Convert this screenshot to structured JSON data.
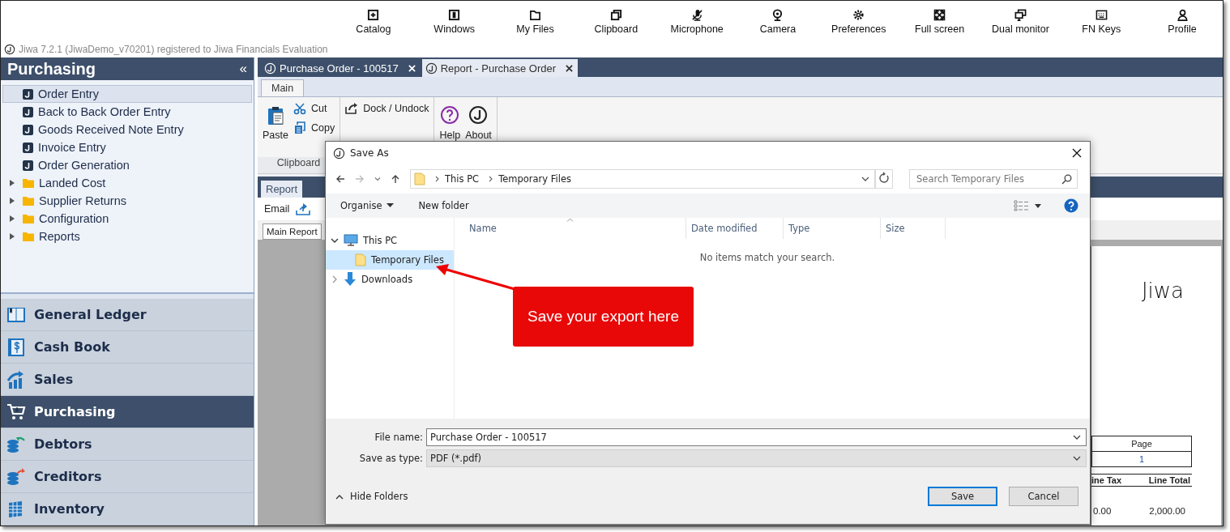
{
  "toolbar": [
    {
      "label": "Catalog"
    },
    {
      "label": "Windows"
    },
    {
      "label": "My Files"
    },
    {
      "label": "Clipboard"
    },
    {
      "label": "Microphone"
    },
    {
      "label": "Camera"
    },
    {
      "label": "Preferences"
    },
    {
      "label": "Full screen"
    },
    {
      "label": "Dual monitor"
    },
    {
      "label": "FN Keys"
    },
    {
      "label": "Profile"
    }
  ],
  "app_title": "Jiwa 7.2.1 (JiwaDemo_v70201) registered to Jiwa Financials Evaluation",
  "sidebar": {
    "title": "Purchasing",
    "collapse": "«",
    "items": [
      {
        "label": "Order Entry",
        "kind": "form",
        "selected": true
      },
      {
        "label": "Back to Back Order Entry",
        "kind": "form",
        "selected": false
      },
      {
        "label": "Goods Received Note Entry",
        "kind": "form",
        "selected": false
      },
      {
        "label": "Invoice Entry",
        "kind": "form",
        "selected": false
      },
      {
        "label": "Order Generation",
        "kind": "form",
        "selected": false
      },
      {
        "label": "Landed Cost",
        "kind": "folder",
        "selected": false
      },
      {
        "label": "Supplier Returns",
        "kind": "folder",
        "selected": false
      },
      {
        "label": "Configuration",
        "kind": "folder",
        "selected": false
      },
      {
        "label": "Reports",
        "kind": "folder",
        "selected": false
      }
    ]
  },
  "modules": [
    {
      "label": "General Ledger",
      "selected": false
    },
    {
      "label": "Cash Book",
      "selected": false
    },
    {
      "label": "Sales",
      "selected": false
    },
    {
      "label": "Purchasing",
      "selected": true
    },
    {
      "label": "Debtors",
      "selected": false
    },
    {
      "label": "Creditors",
      "selected": false
    },
    {
      "label": "Inventory",
      "selected": false
    }
  ],
  "document_tabs": [
    {
      "label": "Purchase Order - 100517",
      "selected": false
    },
    {
      "label": "Report - Purchase Order",
      "selected": true
    }
  ],
  "ribbon": {
    "tabs": [
      {
        "label": "Main",
        "selected": true
      }
    ],
    "groups": [
      {
        "label": "Clipboard",
        "buttons": [
          {
            "label": "Paste",
            "kind": "large"
          },
          {
            "label": "Cut",
            "kind": "small"
          },
          {
            "label": "Copy",
            "kind": "small"
          }
        ]
      },
      {
        "buttons": [
          {
            "label": "Dock / Undock",
            "kind": "small"
          }
        ]
      },
      {
        "buttons": [
          {
            "label": "Help",
            "kind": "large"
          },
          {
            "label": "About",
            "kind": "large"
          }
        ]
      }
    ]
  },
  "report": {
    "tabs": [
      {
        "label": "Report",
        "selected": true
      }
    ],
    "email": "Email",
    "page_tabs": [
      {
        "label": "Main Report",
        "selected": true
      }
    ],
    "page": {
      "logo": "Jiwa",
      "page_label": "Page",
      "page_number": "1",
      "columns": [
        "ine Tax",
        "Line Total"
      ],
      "values": [
        "0.00",
        "2,000.00"
      ]
    }
  },
  "dialog": {
    "title": "Save As",
    "breadcrumb": [
      "This PC",
      "Temporary Files"
    ],
    "search_placeholder": "Search Temporary Files",
    "commands": [
      "Organise",
      "New folder"
    ],
    "nav": [
      {
        "label": "This PC",
        "expanded": true,
        "selected": false,
        "children": [
          {
            "label": "Temporary Files",
            "selected": true
          }
        ]
      },
      {
        "label": "Downloads",
        "expanded": false,
        "selected": false
      }
    ],
    "columns": [
      "Name",
      "Date modified",
      "Type",
      "Size"
    ],
    "empty_message": "No items match your search.",
    "file_name_label": "File name:",
    "file_name": "Purchase Order - 100517",
    "type_label": "Save as type:",
    "save_type": "PDF (*.pdf)",
    "hide_folders": "Hide Folders",
    "buttons": [
      {
        "label": "Save",
        "default": true
      },
      {
        "label": "Cancel",
        "default": false
      }
    ]
  },
  "callout": {
    "text": "Save your export here"
  }
}
